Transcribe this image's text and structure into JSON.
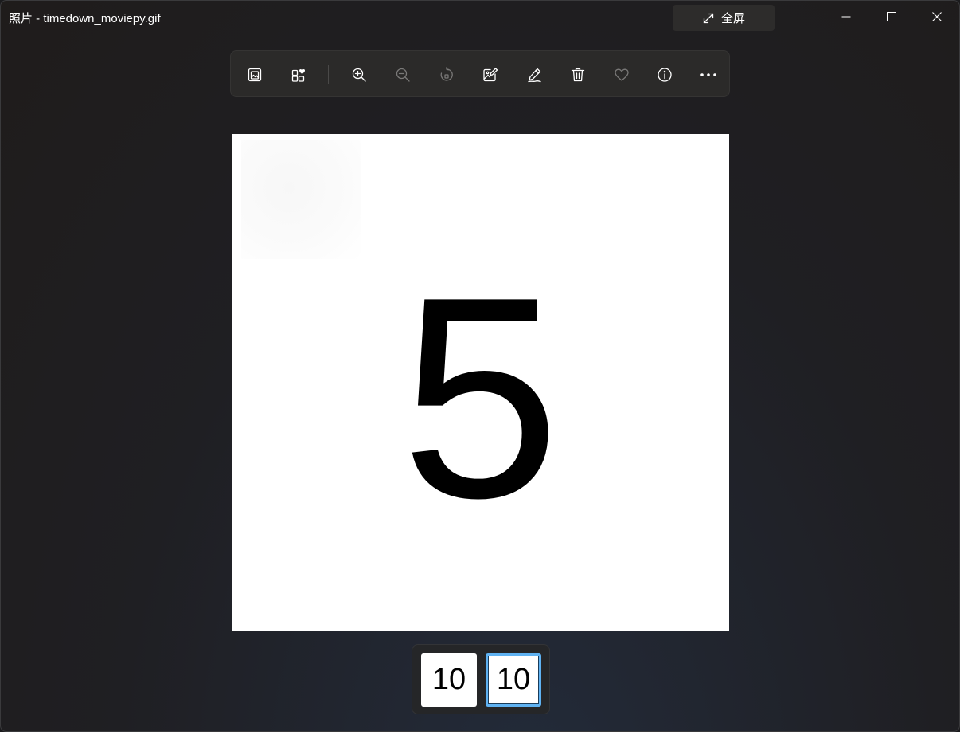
{
  "window": {
    "title": "照片 - timedown_moviepy.gif",
    "fullscreen_label": "全屏"
  },
  "toolbar": {
    "buttons": [
      {
        "name": "view-actual-size",
        "icon": "image-frame-icon",
        "enabled": true
      },
      {
        "name": "add-to-album",
        "icon": "album-heart-icon",
        "enabled": true
      },
      {
        "name": "zoom-in",
        "icon": "zoom-in-icon",
        "enabled": true
      },
      {
        "name": "zoom-out",
        "icon": "zoom-out-icon",
        "enabled": false
      },
      {
        "name": "rotate",
        "icon": "rotate-icon",
        "enabled": false
      },
      {
        "name": "edit-image",
        "icon": "edit-image-icon",
        "enabled": true
      },
      {
        "name": "draw",
        "icon": "pen-icon",
        "enabled": true
      },
      {
        "name": "delete",
        "icon": "trash-icon",
        "enabled": true
      },
      {
        "name": "favorite",
        "icon": "heart-icon",
        "enabled": false
      },
      {
        "name": "file-info",
        "icon": "info-icon",
        "enabled": true
      },
      {
        "name": "more",
        "icon": "ellipsis-icon",
        "enabled": true
      }
    ]
  },
  "image": {
    "current_frame_text": "5"
  },
  "filmstrip": {
    "thumbnails": [
      {
        "label": "10",
        "selected": false
      },
      {
        "label": "10",
        "selected": true
      }
    ]
  },
  "colors": {
    "background": "#1f1e1d",
    "toolbar": "#2b2a29",
    "accent": "#5fb2f2",
    "icon_enabled": "#ffffff",
    "icon_disabled": "#7a7978"
  }
}
